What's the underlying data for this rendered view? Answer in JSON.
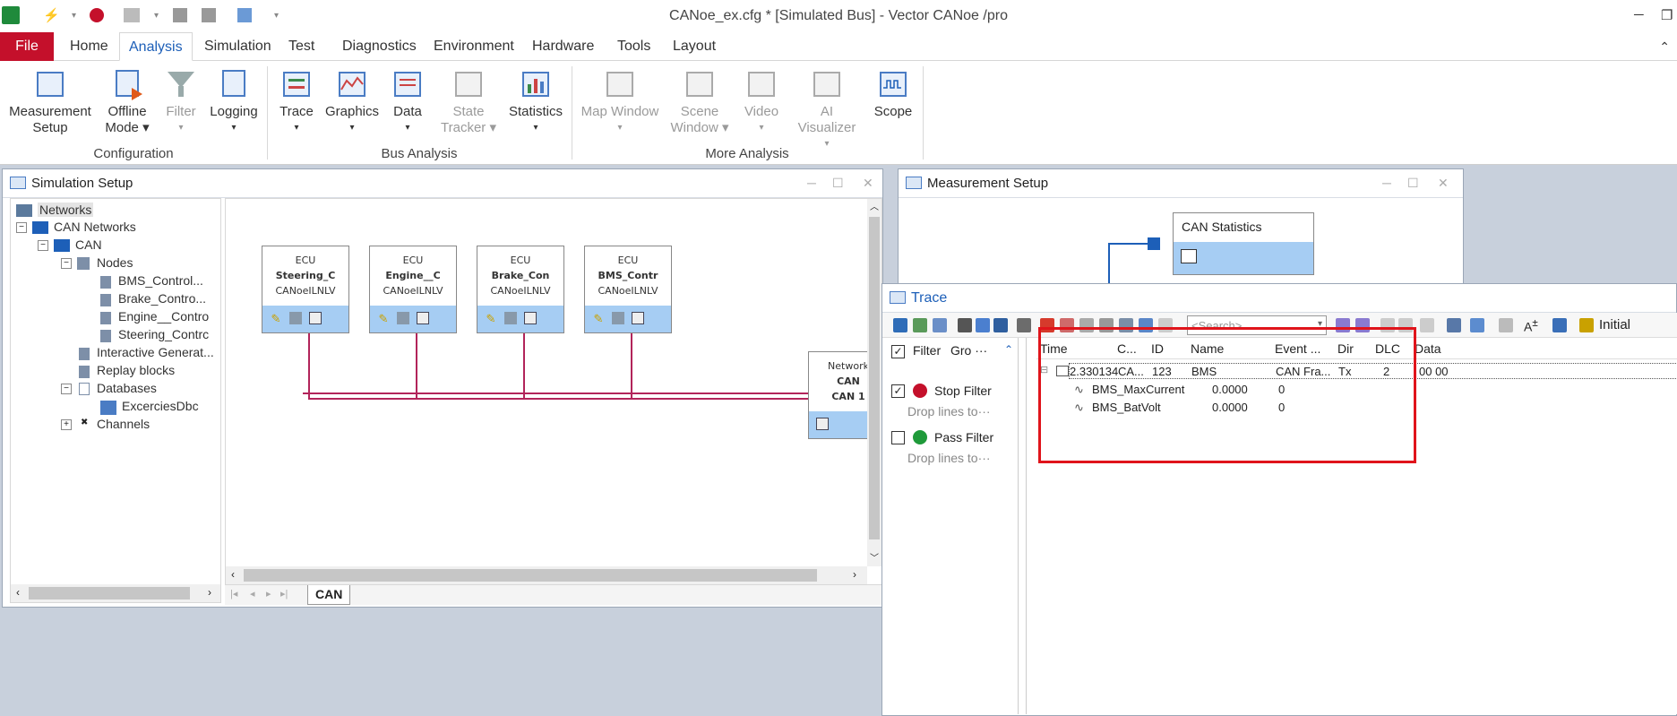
{
  "window": {
    "title": "CANoe_ex.cfg * [Simulated Bus] - Vector CANoe /pro"
  },
  "ribbon_tabs": [
    "File",
    "Home",
    "Analysis",
    "Simulation",
    "Test",
    "Diagnostics",
    "Environment",
    "Hardware",
    "Tools",
    "Layout"
  ],
  "ribbon": {
    "measurement_setup": "Measurement\nSetup",
    "measurement_setup_l1": "Measurement",
    "measurement_setup_l2": "Setup",
    "offline_mode_l1": "Offline",
    "offline_mode_l2": "Mode",
    "filter": "Filter",
    "logging": "Logging",
    "trace": "Trace",
    "graphics": "Graphics",
    "data": "Data",
    "state_tracker_l1": "State",
    "state_tracker_l2": "Tracker",
    "statistics": "Statistics",
    "map_window": "Map Window",
    "scene_window_l1": "Scene",
    "scene_window_l2": "Window",
    "video": "Video",
    "ai_visualizer": "AI Visualizer",
    "scope": "Scope",
    "group_configuration": "Configuration",
    "group_bus_analysis": "Bus Analysis",
    "group_more_analysis": "More Analysis"
  },
  "simulation_setup": {
    "title": "Simulation Setup",
    "tree": {
      "networks": "Networks",
      "can_networks": "CAN Networks",
      "can": "CAN",
      "nodes": "Nodes",
      "node_items": [
        "BMS_Control...",
        "Brake_Contro...",
        "Engine__Contro",
        "Steering_Contrc"
      ],
      "interactive_generator": "Interactive Generat...",
      "replay_blocks": "Replay blocks",
      "databases": "Databases",
      "excercies_dbc": "ExcerciesDbc",
      "channels": "Channels"
    },
    "ecus": [
      {
        "type": "ECU",
        "name": "Steering_C",
        "sub": "CANoeILNLV"
      },
      {
        "type": "ECU",
        "name": "Engine__C",
        "sub": "CANoeILNLV"
      },
      {
        "type": "ECU",
        "name": "Brake_Con",
        "sub": "CANoeILNLV"
      },
      {
        "type": "ECU",
        "name": "BMS_Contr",
        "sub": "CANoeILNLV"
      }
    ],
    "network_box": {
      "type": "Network",
      "name": "CAN",
      "channel": "CAN 1"
    },
    "bottom_tab": "CAN"
  },
  "measurement_setup": {
    "title": "Measurement Setup",
    "block": "CAN Statistics"
  },
  "trace": {
    "title": "Trace",
    "search_placeholder": "<Search>",
    "initial_label": "Initial",
    "filter_panel": {
      "header_filter": "Filter",
      "header_group": "Gro ···",
      "stop_filter": "Stop Filter",
      "stop_hint": "Drop  lines  to···",
      "pass_filter": "Pass Filter",
      "pass_hint": "Drop  lines  to···"
    },
    "columns": [
      "Time",
      "C...",
      "ID",
      "Name",
      "Event ...",
      "Dir",
      "DLC",
      "Data"
    ],
    "rows": [
      {
        "time": "2.330134",
        "chn": "CA...",
        "id": "123",
        "name": "BMS",
        "event": "CAN Fra...",
        "dir": "Tx",
        "dlc": "2",
        "data": "00  00"
      }
    ],
    "signals": [
      {
        "name": "BMS_MaxCurrent",
        "value": "0.0000",
        "raw": "0"
      },
      {
        "name": "BMS_BatVolt",
        "value": "0.0000",
        "raw": "0"
      }
    ],
    "highlight_color": "#e0141b"
  },
  "colors": {
    "file_tab": "#c4102b",
    "accent": "#1d5fb8",
    "bus_line": "#b2245a",
    "ecu_bar": "#a6cdf3"
  }
}
